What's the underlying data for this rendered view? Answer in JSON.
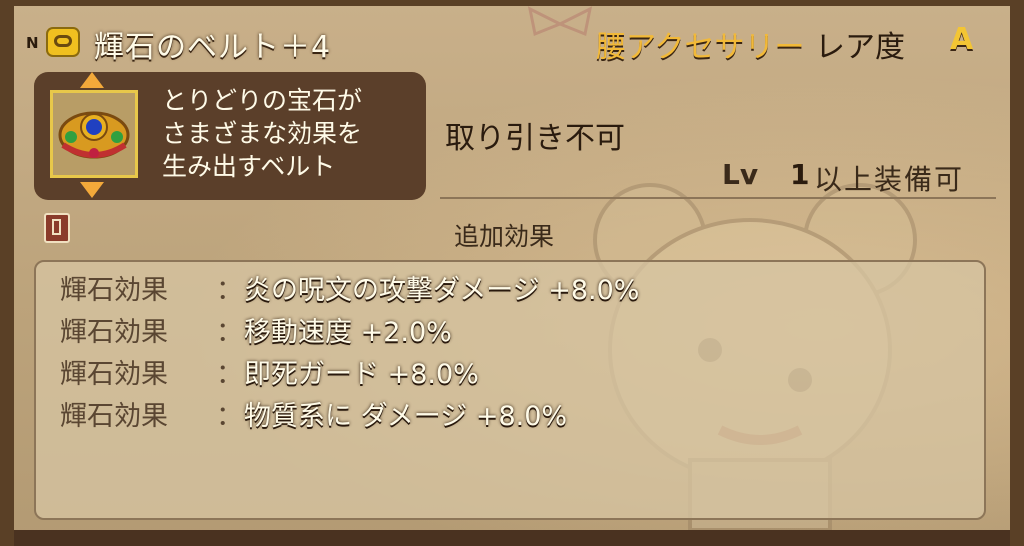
{
  "item": {
    "rank": "N",
    "name": "輝石のベルト＋4",
    "slot": "腰アクセサリー",
    "rarity_label": "レア度",
    "rarity_value": "A",
    "description_lines": [
      "とりどりの宝石が",
      "さまざまな効果を",
      "生み出すベルト"
    ],
    "trade_status": "取り引き不可",
    "level_label": "Lv",
    "level_value": "1",
    "level_suffix": "以上装備可"
  },
  "extra_effects": {
    "heading": "追加効果",
    "rows": [
      {
        "label": "輝石効果",
        "colon": "：",
        "text": "炎の呪文の攻撃ダメージ +8.0%"
      },
      {
        "label": "輝石効果",
        "colon": "：",
        "text": "移動速度 +2.0%"
      },
      {
        "label": "輝石効果",
        "colon": "：",
        "text": "即死ガード +8.0%"
      },
      {
        "label": "輝石効果",
        "colon": "：",
        "text": "物質系に ダメージ +8.0%"
      }
    ]
  },
  "colors": {
    "name_text": "#fffbe8",
    "slot_text": "#f2b938",
    "rarity_value": "#f3c534",
    "panel_dark": "#5b3f2a",
    "parchment": "#c9b08a"
  },
  "icons": {
    "item_small": "belt-icon",
    "item_large": "jeweled-belt-icon",
    "scroll_up": "arrow-up-icon",
    "scroll_down": "arrow-down-icon",
    "book": "book-icon"
  }
}
